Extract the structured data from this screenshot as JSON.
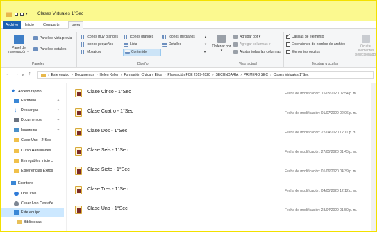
{
  "window": {
    "title": "Clases Virtuales 1°Sec"
  },
  "tabs": [
    {
      "label": "Archivo"
    },
    {
      "label": "Inicio"
    },
    {
      "label": "Compartir"
    },
    {
      "label": "Vista"
    }
  ],
  "ribbon": {
    "panes": {
      "nav_pane": "Panel de navegación ▾",
      "preview": "Panel de vista previa",
      "details": "Panel de detalles",
      "label": "Paneles"
    },
    "layout": {
      "items": [
        "Iconos muy grandes",
        "Iconos grandes",
        "Iconos medianos",
        "Iconos pequeños",
        "Lista",
        "Detalles",
        "Mosaicos",
        "Contenido"
      ],
      "label": "Diseño"
    },
    "current_view": {
      "sort": "Ordenar por ▾",
      "group": "Agrupar por ▾",
      "add_columns": "Agregar columnas ▾",
      "fit_columns": "Ajustar todas las columnas",
      "label": "Vista actual"
    },
    "show_hide": {
      "checkboxes": "Casillas de elemento",
      "extensions": "Extensiones de nombre de archivo",
      "hidden": "Elementos ocultos",
      "hide_selected": "Ocultar elementos seleccionados",
      "label": "Mostrar u ocultar"
    }
  },
  "address": {
    "parts": [
      "Este equipo",
      "Documentos",
      "Helen Keller",
      "Formación Cívica y Ética",
      "Planeación FCE 2019-2020",
      "SECUNDARIA",
      "PRIMERO SEC",
      "Clases Virtuales 1°Sec"
    ]
  },
  "sidebar": {
    "items": [
      {
        "label": "Acceso rápido"
      },
      {
        "label": "Escritorio"
      },
      {
        "label": "Descargas"
      },
      {
        "label": "Documentos"
      },
      {
        "label": "Imágenes"
      },
      {
        "label": "Clase Uno - 2°Sec"
      },
      {
        "label": "Curso Habilidades"
      },
      {
        "label": "Entregables inicio c"
      },
      {
        "label": "Experiencias Éxitos"
      },
      {
        "label": "Escritorio"
      },
      {
        "label": "OneDrive"
      },
      {
        "label": "Cesar Ivan Castañe"
      },
      {
        "label": "Este equipo"
      },
      {
        "label": "Bibliotecas"
      }
    ]
  },
  "files": [
    {
      "name": "Clase Cinco - 1°Sec",
      "date": "Fecha de modificación: 15/05/2020 02:54 p. m."
    },
    {
      "name": "Clase Cuatro - 1°Sec",
      "date": "Fecha de modificación: 01/07/2020 02:06 p. m."
    },
    {
      "name": "Clase Dos - 1°Sec",
      "date": "Fecha de modificación: 27/04/2020 12:11 p. m."
    },
    {
      "name": "Clase Seis - 1°Sec",
      "date": "Fecha de modificación: 27/05/2020 01:45 p. m."
    },
    {
      "name": "Clase Siete - 1°Sec",
      "date": "Fecha de modificación: 01/06/2020 04:39 p. m."
    },
    {
      "name": "Clase Tres - 1°Sec",
      "date": "Fecha de modificación: 04/05/2020 12:12 p. m."
    },
    {
      "name": "Clase Uno - 1°Sec",
      "date": "Fecha de modificación: 23/04/2020 01:50 p. m."
    }
  ],
  "colors": {
    "title_bg": "#fbf98f",
    "accent": "#1d62b3",
    "selection": "#cce8ff",
    "border": "#f3e000"
  }
}
